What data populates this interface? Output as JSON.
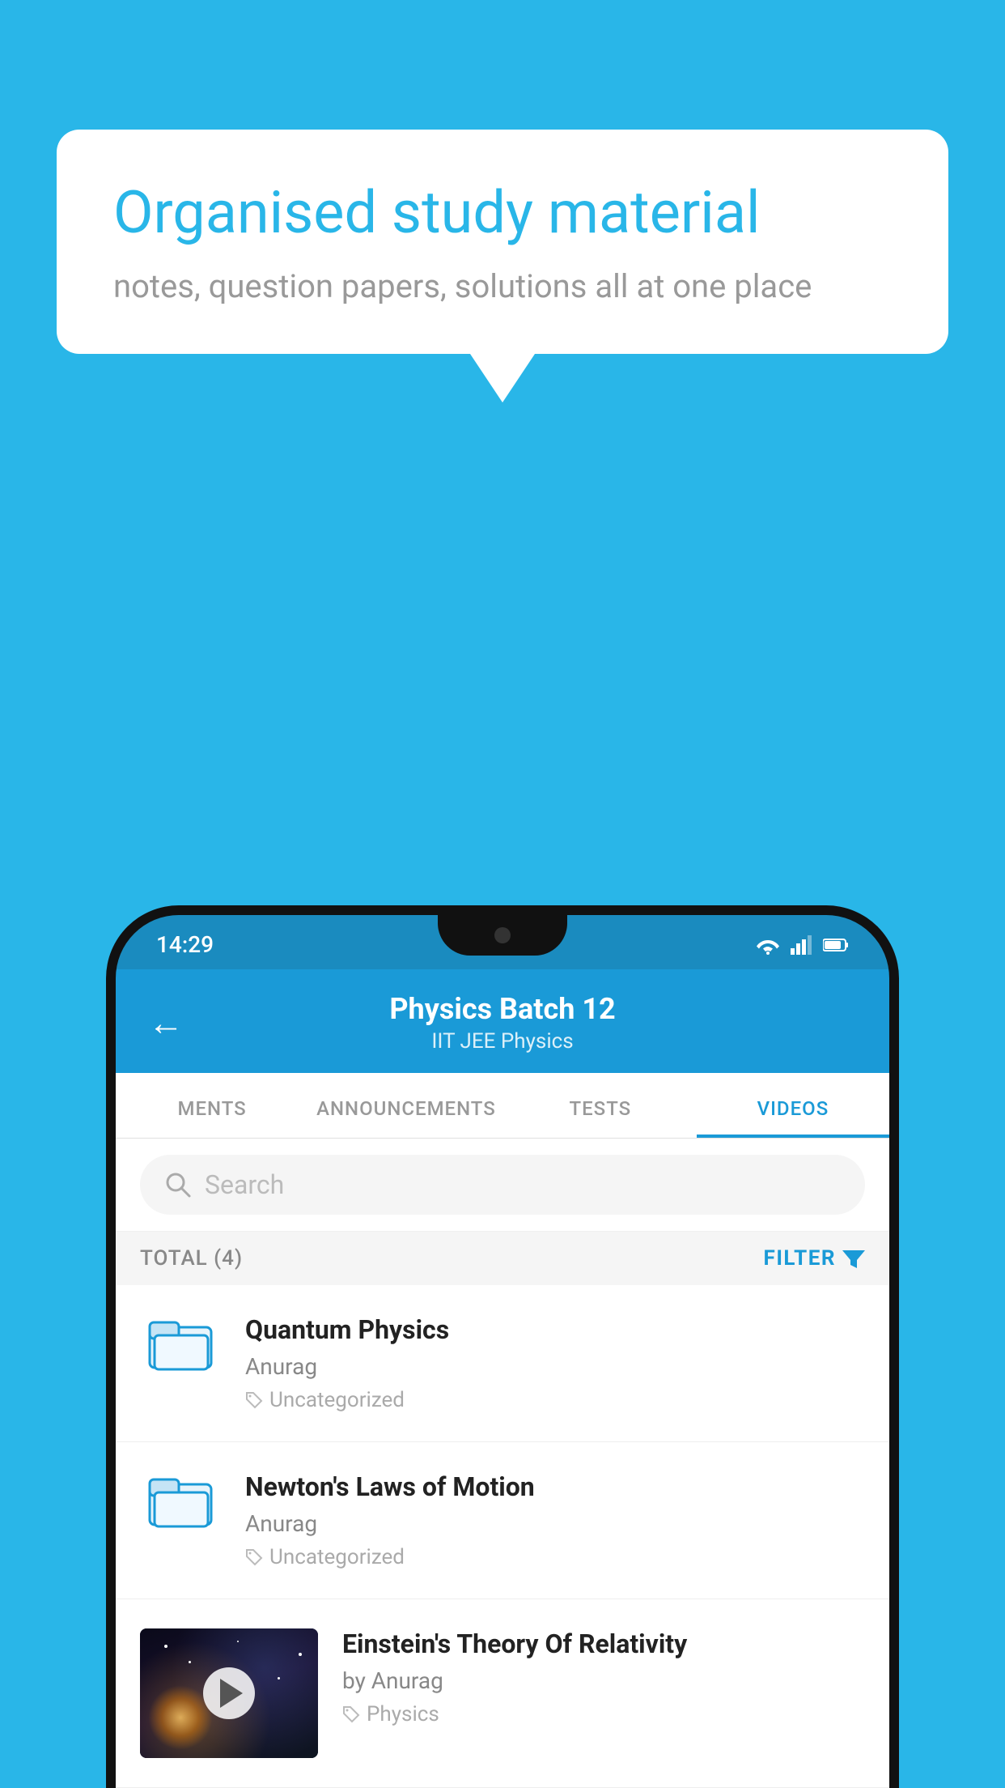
{
  "background_color": "#29b6e8",
  "speech_bubble": {
    "title": "Organised study material",
    "subtitle": "notes, question papers, solutions all at one place"
  },
  "status_bar": {
    "time": "14:29",
    "icons": [
      "wifi",
      "signal",
      "battery"
    ]
  },
  "header": {
    "back_label": "←",
    "title": "Physics Batch 12",
    "subtitle_tags": "IIT JEE    Physics"
  },
  "tabs": [
    {
      "label": "MENTS",
      "active": false
    },
    {
      "label": "ANNOUNCEMENTS",
      "active": false
    },
    {
      "label": "TESTS",
      "active": false
    },
    {
      "label": "VIDEOS",
      "active": true
    }
  ],
  "search": {
    "placeholder": "Search"
  },
  "filter_row": {
    "total_label": "TOTAL (4)",
    "filter_label": "FILTER"
  },
  "videos": [
    {
      "id": 1,
      "title": "Quantum Physics",
      "author": "Anurag",
      "tag": "Uncategorized",
      "has_thumbnail": false
    },
    {
      "id": 2,
      "title": "Newton's Laws of Motion",
      "author": "Anurag",
      "tag": "Uncategorized",
      "has_thumbnail": false
    },
    {
      "id": 3,
      "title": "Einstein's Theory Of Relativity",
      "author": "by Anurag",
      "tag": "Physics",
      "has_thumbnail": true
    }
  ]
}
